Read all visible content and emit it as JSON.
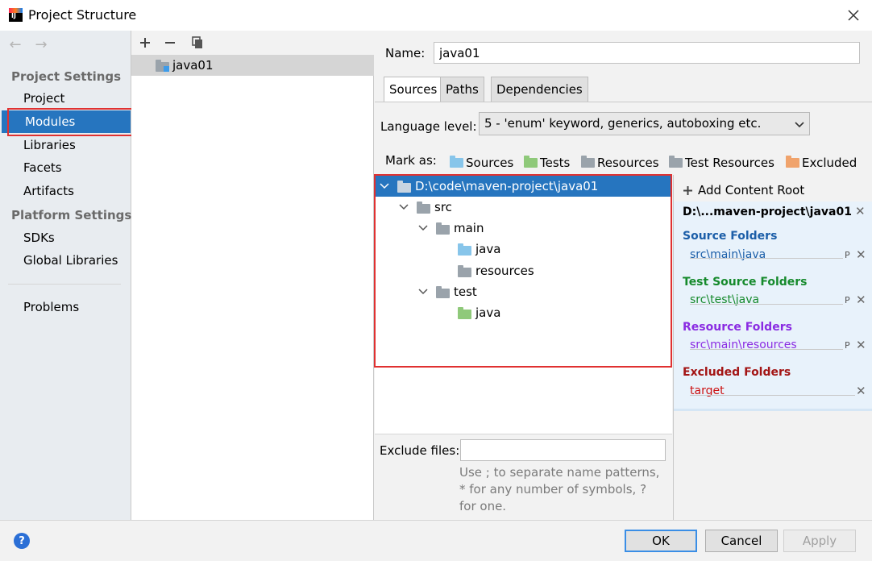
{
  "window": {
    "title": "Project Structure"
  },
  "nav": {
    "back": "←",
    "forward": "→",
    "project_settings_header": "Project Settings",
    "project_settings_items": [
      "Project",
      "Modules",
      "Libraries",
      "Facets",
      "Artifacts"
    ],
    "selected": "Modules",
    "platform_settings_header": "Platform Settings",
    "platform_settings_items": [
      "SDKs",
      "Global Libraries"
    ],
    "problems": "Problems"
  },
  "modules": {
    "items": [
      "java01"
    ]
  },
  "module": {
    "name_label": "Name:",
    "name_value": "java01",
    "tabs": [
      "Sources",
      "Paths",
      "Dependencies"
    ],
    "active_tab": "Sources",
    "language_level_label": "Language level:",
    "language_level_value": "5 - 'enum' keyword, generics, autoboxing etc.",
    "mark_as_label": "Mark as:",
    "mark_as": [
      "Sources",
      "Tests",
      "Resources",
      "Test Resources",
      "Excluded"
    ]
  },
  "tree": {
    "root": "D:\\code\\maven-project\\java01",
    "src": "src",
    "main": "main",
    "main_java": "java",
    "main_resources": "resources",
    "test": "test",
    "test_java": "java"
  },
  "exclude": {
    "label": "Exclude files:",
    "value": "",
    "hint": "Use ; to separate name patterns, * for any number of symbols, ? for one."
  },
  "content_roots": {
    "add_label": "Add Content Root",
    "root_path": "D:\\...maven-project\\java01",
    "source_header": "Source Folders",
    "source_path": "src\\main\\java",
    "test_header": "Test Source Folders",
    "test_path": "src\\test\\java",
    "resource_header": "Resource Folders",
    "resource_path": "src\\main\\resources",
    "excluded_header": "Excluded Folders",
    "excluded_path": "target",
    "properties_glyph": "P"
  },
  "buttons": {
    "ok": "OK",
    "cancel": "Cancel",
    "apply": "Apply",
    "help": "?"
  },
  "colors": {
    "selection": "#2675bf",
    "source_blue": "#1b5ea8",
    "test_green": "#168a2c",
    "resource_purple": "#8a2be2",
    "excluded_red": "#a31515",
    "folder_source": "#87c5ea",
    "folder_test": "#8fc97a",
    "folder_plain": "#9aa3ab",
    "folder_excluded": "#f0a36c",
    "highlight_red": "#e03131"
  }
}
